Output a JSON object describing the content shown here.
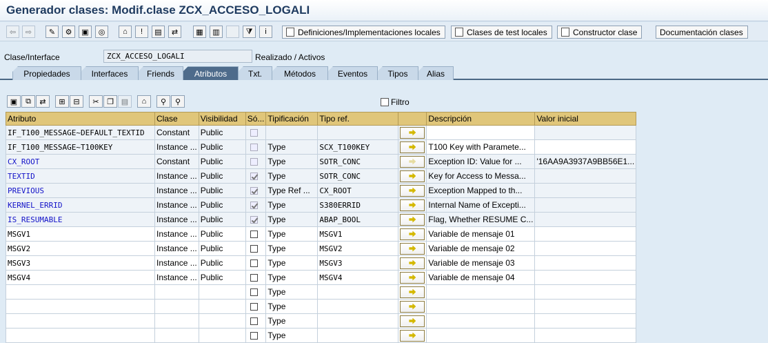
{
  "window": {
    "title": "Generador clases: Modif.clase ZCX_ACCESO_LOGALI"
  },
  "toolbar": {
    "buttons": [
      {
        "name": "back-icon"
      },
      {
        "name": "forward-icon"
      },
      {
        "name": "other-object-icon"
      },
      {
        "name": "display-change-icon"
      },
      {
        "name": "active-inactive-icon"
      },
      {
        "name": "check-icon"
      },
      {
        "name": "test-icon"
      },
      {
        "name": "activate-icon"
      },
      {
        "name": "where-used-icon"
      },
      {
        "name": "object-list-icon"
      },
      {
        "name": "navigation-window-icon"
      },
      {
        "name": "filter-icon"
      },
      {
        "name": "info-icon"
      }
    ],
    "definitions_label": "Definiciones/Implementaciones locales",
    "test_classes_label": "Clases de test locales",
    "constructor_label": "Constructor clase",
    "documentation_label": "Documentación clases"
  },
  "header": {
    "class_label": "Clase/Interface",
    "class_value": "ZCX_ACCESO_LOGALI",
    "status": "Realizado / Activos"
  },
  "tabs": [
    "Propiedades",
    "Interfaces",
    "Friends",
    "Atributos",
    "Txt.",
    "Métodos",
    "Eventos",
    "Tipos",
    "Alias"
  ],
  "active_tab": "Atributos",
  "filter_label": "Filtro",
  "grid": {
    "headers": [
      "Atributo",
      "Clase",
      "Visibilidad",
      "Só...",
      "Tipificación",
      "Tipo ref.",
      "",
      "Descripción",
      "Valor inicial"
    ],
    "rows": [
      {
        "attr": "IF_T100_MESSAGE~DEFAULT_TEXTID",
        "clase": "Constant",
        "vis": "Public",
        "ro": "disabled",
        "tip": "",
        "ref": "",
        "desc": "",
        "init": "",
        "blue": false
      },
      {
        "attr": "IF_T100_MESSAGE~T100KEY",
        "clase": "Instance ...",
        "vis": "Public",
        "ro": "disabled",
        "tip": "Type",
        "ref": "SCX_T100KEY",
        "desc": "T100 Key with Paramete...",
        "init": "",
        "blue": false
      },
      {
        "attr": "CX_ROOT",
        "clase": "Constant",
        "vis": "Public",
        "ro": "disabled",
        "tip": "Type",
        "ref": "SOTR_CONC",
        "desc": "Exception ID: Value for ...",
        "init": "'16AA9A3937A9BB56E1...",
        "blue": true
      },
      {
        "attr": "TEXTID",
        "clase": "Instance ...",
        "vis": "Public",
        "ro": "checked",
        "tip": "Type",
        "ref": "SOTR_CONC",
        "desc": "Key for Access to Messa...",
        "init": "",
        "blue": true
      },
      {
        "attr": "PREVIOUS",
        "clase": "Instance ...",
        "vis": "Public",
        "ro": "checked",
        "tip": "Type Ref ...",
        "ref": "CX_ROOT",
        "desc": "Exception Mapped to th...",
        "init": "",
        "blue": true
      },
      {
        "attr": "KERNEL_ERRID",
        "clase": "Instance ...",
        "vis": "Public",
        "ro": "checked",
        "tip": "Type",
        "ref": "S380ERRID",
        "desc": "Internal Name of Excepti...",
        "init": "",
        "blue": true
      },
      {
        "attr": "IS_RESUMABLE",
        "clase": "Instance ...",
        "vis": "Public",
        "ro": "checked",
        "tip": "Type",
        "ref": "ABAP_BOOL",
        "desc": "Flag, Whether RESUME C...",
        "init": "",
        "blue": true
      },
      {
        "attr": "MSGV1",
        "clase": "Instance ...",
        "vis": "Public",
        "ro": "empty",
        "tip": "Type",
        "ref": "MSGV1",
        "desc": "Variable de mensaje 01",
        "init": "",
        "blue": false
      },
      {
        "attr": "MSGV2",
        "clase": "Instance ...",
        "vis": "Public",
        "ro": "empty",
        "tip": "Type",
        "ref": "MSGV2",
        "desc": "Variable de mensaje 02",
        "init": "",
        "blue": false
      },
      {
        "attr": "MSGV3",
        "clase": "Instance ...",
        "vis": "Public",
        "ro": "empty",
        "tip": "Type",
        "ref": "MSGV3",
        "desc": "Variable de mensaje 03",
        "init": "",
        "blue": false
      },
      {
        "attr": "MSGV4",
        "clase": "Instance ...",
        "vis": "Public",
        "ro": "empty",
        "tip": "Type",
        "ref": "MSGV4",
        "desc": "Variable de mensaje 04",
        "init": "",
        "blue": false
      },
      {
        "attr": "",
        "clase": "",
        "vis": "",
        "ro": "empty",
        "tip": "Type",
        "ref": "",
        "desc": "",
        "init": "",
        "blue": false
      },
      {
        "attr": "",
        "clase": "",
        "vis": "",
        "ro": "empty",
        "tip": "Type",
        "ref": "",
        "desc": "",
        "init": "",
        "blue": false
      },
      {
        "attr": "",
        "clase": "",
        "vis": "",
        "ro": "empty",
        "tip": "Type",
        "ref": "",
        "desc": "",
        "init": "",
        "blue": false
      },
      {
        "attr": "",
        "clase": "",
        "vis": "",
        "ro": "empty",
        "tip": "Type",
        "ref": "",
        "desc": "",
        "init": "",
        "blue": false
      }
    ]
  }
}
